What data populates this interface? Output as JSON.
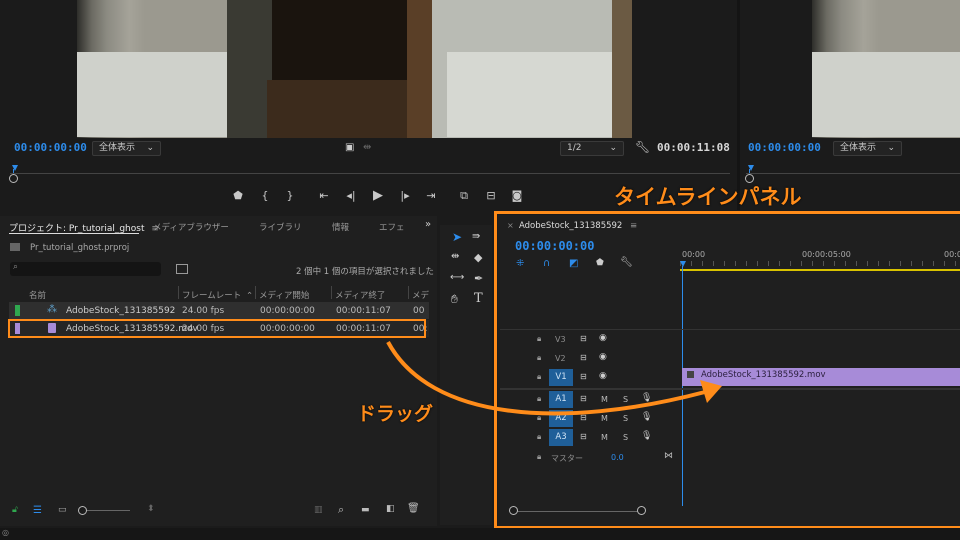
{
  "source_monitor": {
    "timecode": "00:00:00:00",
    "zoom": "全体表示",
    "resolution": "1/2",
    "duration": "00:00:11:08"
  },
  "program_monitor": {
    "timecode": "00:00:00:00",
    "zoom": "全体表示"
  },
  "project_panel": {
    "tabs": [
      "プロジェクト: Pr_tutorial_ghost",
      "メディアブラウザー",
      "ライブラリ",
      "情報",
      "エフェ"
    ],
    "file_name": "Pr_tutorial_ghost.prproj",
    "selection_status": "2 個中 1 個の項目が選択されました",
    "columns": [
      "名前",
      "フレームレート",
      "メディア開始",
      "メディア終了",
      "メデ"
    ],
    "items": [
      {
        "name": "AdobeStock_131385592",
        "fps": "24.00 fps",
        "start": "00:00:00:00",
        "end": "00:00:11:07",
        "extra": "00",
        "color": "#2fa84f"
      },
      {
        "name": "AdobeStock_131385592.mov",
        "fps": "24.00 fps",
        "start": "00:00:00:00",
        "end": "00:00:11:07",
        "extra": "00:",
        "color": "#a78bd8"
      }
    ]
  },
  "timeline": {
    "sequence_name": "AdobeStock_131385592",
    "timecode": "00:00:00:00",
    "ruler": [
      "00:00",
      "00:00:05:00",
      "00:0"
    ],
    "tracks": {
      "video": [
        "V3",
        "V2",
        "V1"
      ],
      "audio": [
        "A1",
        "A2",
        "A3"
      ],
      "master_label": "マスター",
      "master_value": "0.0",
      "m_label": "M",
      "s_label": "S"
    },
    "clip_name": "AdobeStock_131385592.mov"
  },
  "annotations": {
    "timeline_label": "タイムラインパネル",
    "drag_label": "ドラッグ",
    "accent_color": "#ff8c1a"
  }
}
